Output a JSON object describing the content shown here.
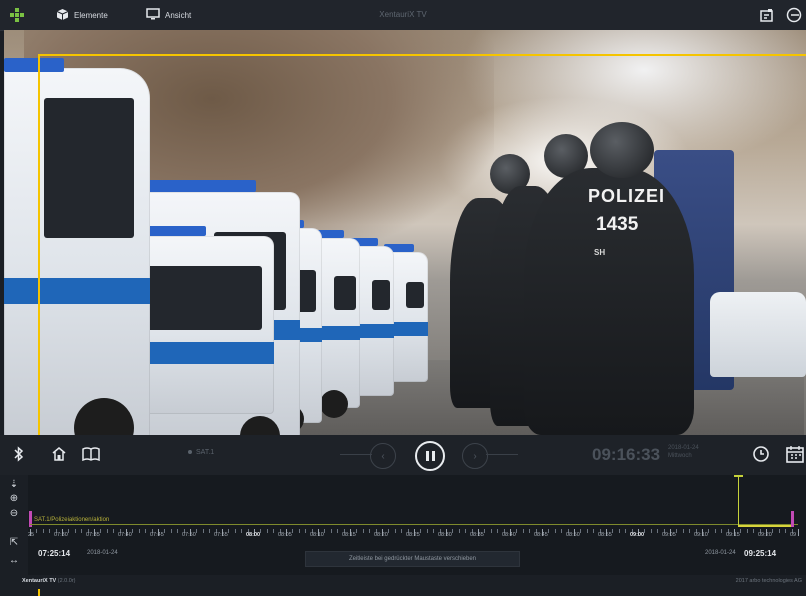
{
  "header": {
    "elements_label": "Elemente",
    "view_label": "Ansicht",
    "title": "XentauriX TV"
  },
  "player": {
    "channel": "SAT.1",
    "time": "09:16:33",
    "date": "2018-01-24",
    "weekday": "Mittwoch"
  },
  "timeline": {
    "track_label": "SAT.1/Polizeiaktionen/aktion",
    "start_time": "07:25:14",
    "start_date": "2018-01-24",
    "end_time": "09:25:14",
    "end_date": "2018-01-24",
    "center_button": "Zeitleiste bei gedrückter Maustaste verschieben",
    "tick_labels": [
      "25",
      "07:30",
      "07:35",
      "07:40",
      "07:45",
      "07:50",
      "07:55",
      "08:00",
      "08:05",
      "08:10",
      "08:15",
      "08:20",
      "08:25",
      "08:30",
      "08:35",
      "08:40",
      "08:45",
      "08:50",
      "08:55",
      "09:00",
      "09:05",
      "09:10",
      "09:15",
      "09:20",
      "09"
    ]
  },
  "footer": {
    "app_name": "XentauriX TV",
    "version": "(2.0.0r)",
    "copyright": "2017 arbo technologies AG"
  },
  "colors": {
    "selection": "#f5c400",
    "track_pink": "#c24ab5",
    "playhead": "#c5d23a"
  }
}
